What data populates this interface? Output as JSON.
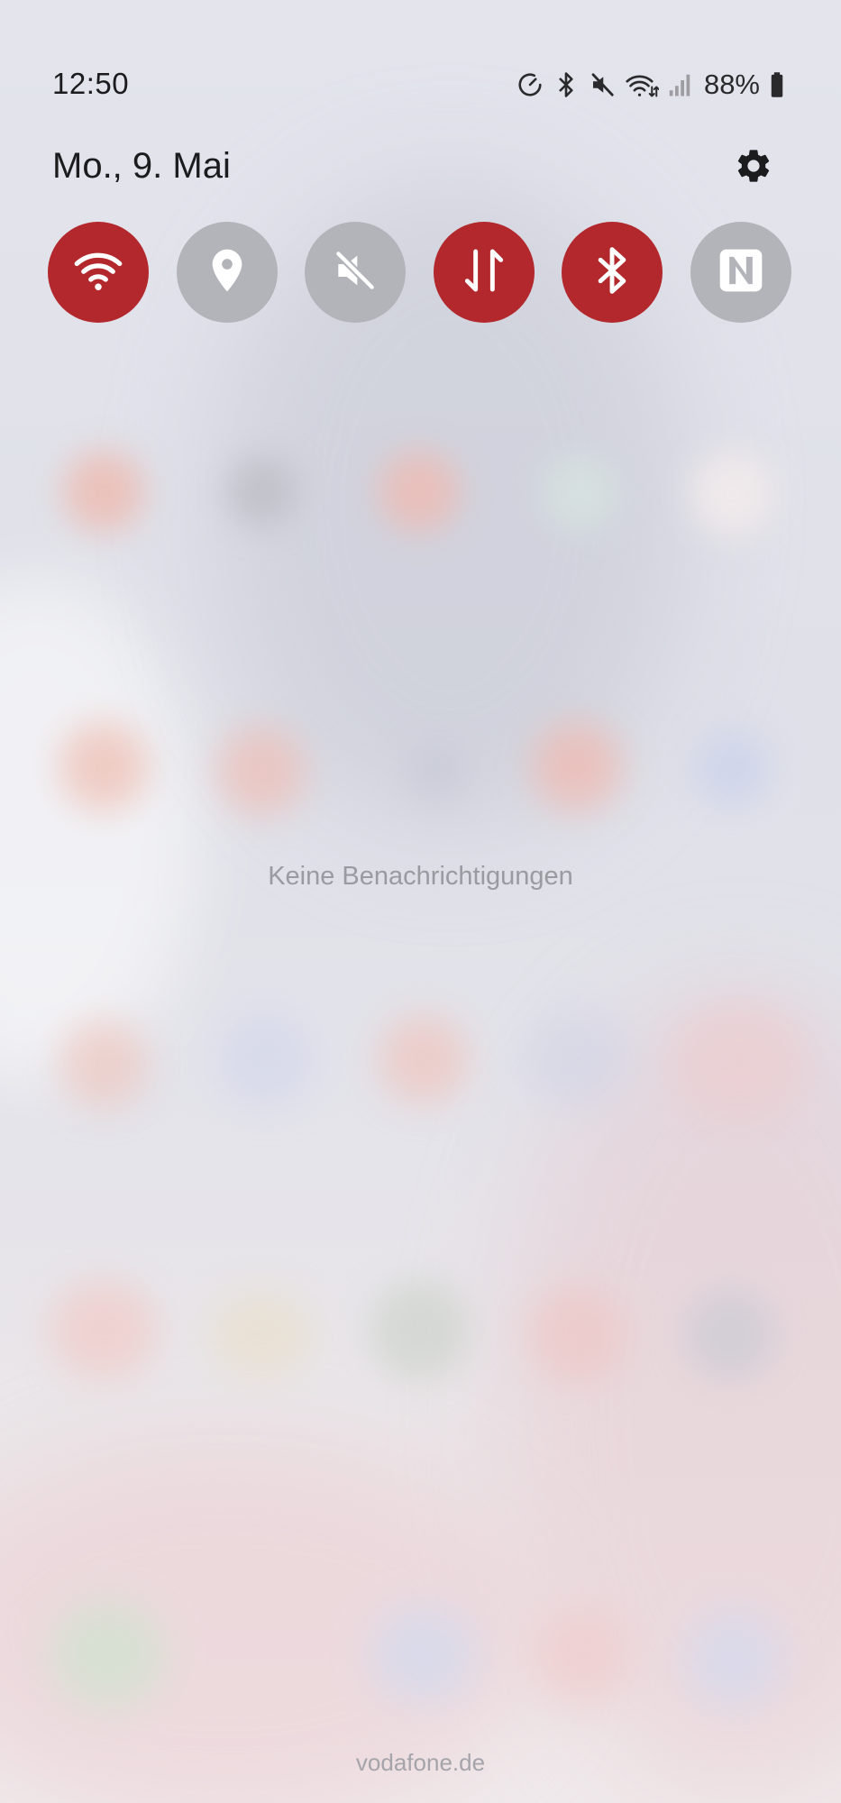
{
  "status_bar": {
    "time": "12:50",
    "battery_percent": "88%",
    "icons": [
      "data-saver-icon",
      "bluetooth-status-icon",
      "mute-status-icon",
      "wifi-status-icon",
      "cellular-signal-icon",
      "battery-icon"
    ]
  },
  "panel": {
    "date": "Mo., 9. Mai",
    "settings_icon": "gear-icon"
  },
  "quick_tiles": [
    {
      "id": "wifi",
      "icon": "wifi-icon",
      "state": "on"
    },
    {
      "id": "location",
      "icon": "location-pin-icon",
      "state": "off"
    },
    {
      "id": "sound",
      "icon": "mute-icon",
      "state": "off"
    },
    {
      "id": "mobile-data",
      "icon": "data-arrows-icon",
      "state": "on"
    },
    {
      "id": "bluetooth",
      "icon": "bluetooth-icon",
      "state": "on"
    },
    {
      "id": "nfc",
      "icon": "nfc-icon",
      "state": "off"
    }
  ],
  "notifications": {
    "empty_text": "Keine Benachrichtigungen"
  },
  "footer": {
    "carrier": "vodafone.de"
  },
  "colors": {
    "tile_on": "#b3282c",
    "tile_off": "#b3b4ba",
    "icon": "#ffffff"
  }
}
